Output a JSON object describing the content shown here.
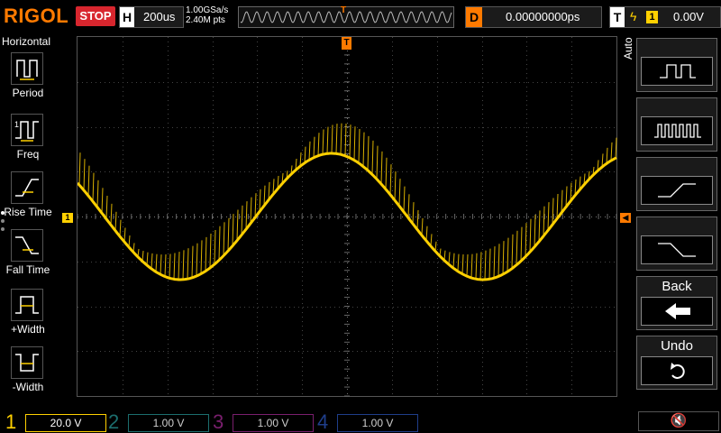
{
  "topbar": {
    "brand": "RIGOL",
    "run_state": "STOP",
    "timebase_label": "H",
    "timebase_value": "200us",
    "sample_rate": "1.00GSa/s",
    "memory_depth": "2.40M pts",
    "trigger_pos_marker": "T",
    "delay_label": "D",
    "delay_value": "0.00000000ps",
    "trigger_label": "T",
    "trigger_source": "1",
    "trigger_level": "0.00V"
  },
  "left_menu": {
    "title": "Horizontal",
    "items": [
      {
        "label": "Period",
        "icon": "period-icon"
      },
      {
        "label": "Freq",
        "icon": "frequency-icon"
      },
      {
        "label": "Rise Time",
        "icon": "rise-time-icon"
      },
      {
        "label": "Fall Time",
        "icon": "fall-time-icon"
      },
      {
        "label": "+Width",
        "icon": "positive-width-icon"
      },
      {
        "label": "-Width",
        "icon": "negative-width-icon"
      }
    ]
  },
  "markers": {
    "trigger_top": "T",
    "channel1": "1"
  },
  "right_menu": {
    "side_label": "Auto",
    "buttons": [
      {
        "label": "",
        "icon": "pulse-single-icon"
      },
      {
        "label": "",
        "icon": "pulse-train-icon"
      },
      {
        "label": "",
        "icon": "rising-edge-icon"
      },
      {
        "label": "",
        "icon": "falling-edge-icon"
      },
      {
        "label": "Back",
        "icon": "back-arrow-icon"
      },
      {
        "label": "Undo",
        "icon": "undo-icon"
      }
    ]
  },
  "channels": [
    {
      "num": "1",
      "value": "20.0 V",
      "color": "#ffd000"
    },
    {
      "num": "2",
      "value": "1.00 V",
      "color": "#1c6e6e"
    },
    {
      "num": "3",
      "value": "1.00 V",
      "color": "#7a1f6e"
    },
    {
      "num": "4",
      "value": "1.00 V",
      "color": "#1f3e8a"
    }
  ],
  "colors": {
    "trace": "#ffd000",
    "accent": "#ff7a00",
    "stop": "#d8262e"
  },
  "speaker_icon": "speaker-mute-icon"
}
